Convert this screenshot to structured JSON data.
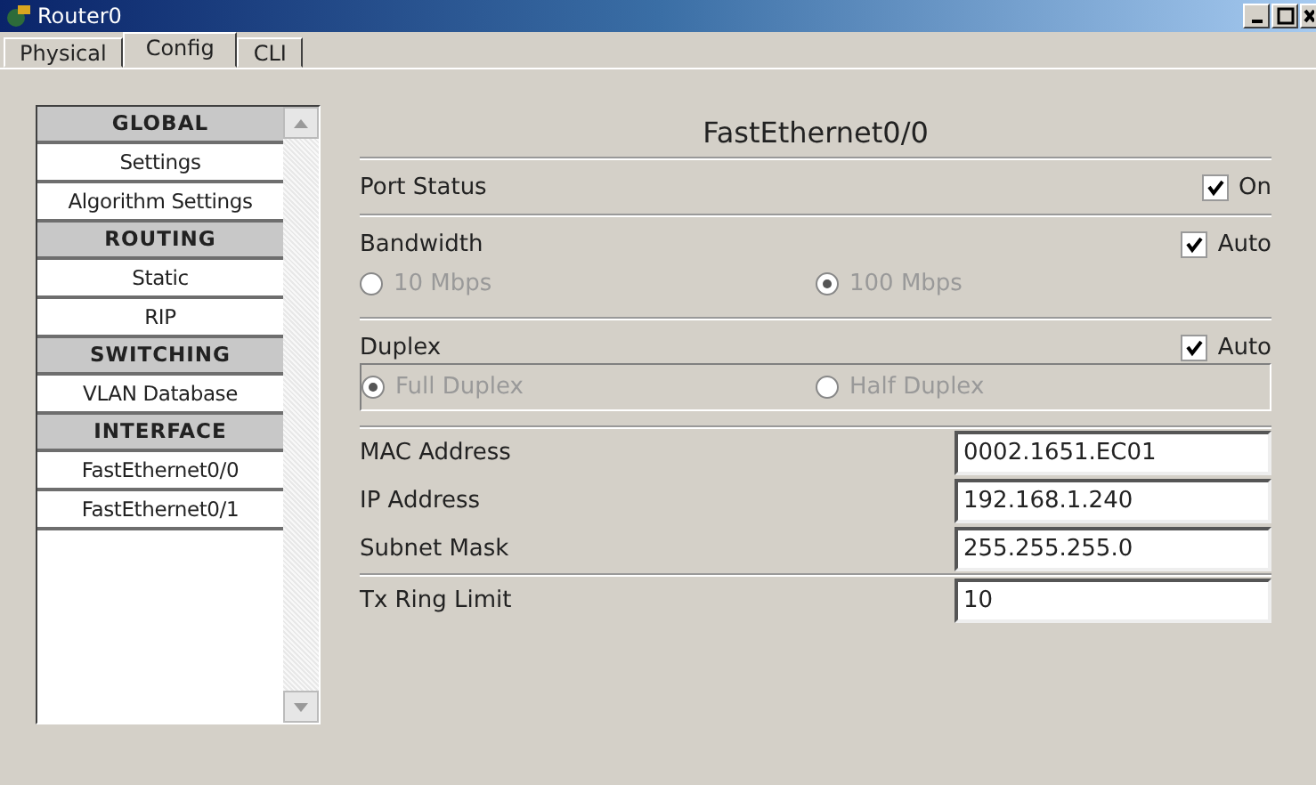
{
  "window": {
    "title": "Router0"
  },
  "tabs": [
    {
      "label": "Physical",
      "selected": false
    },
    {
      "label": "Config",
      "selected": true
    },
    {
      "label": "CLI",
      "selected": false
    }
  ],
  "sidebar": {
    "items": [
      {
        "kind": "header",
        "label": "GLOBAL"
      },
      {
        "kind": "item",
        "label": "Settings"
      },
      {
        "kind": "item",
        "label": "Algorithm Settings"
      },
      {
        "kind": "header",
        "label": "ROUTING"
      },
      {
        "kind": "item",
        "label": "Static"
      },
      {
        "kind": "item",
        "label": "RIP"
      },
      {
        "kind": "header",
        "label": "SWITCHING"
      },
      {
        "kind": "item",
        "label": "VLAN Database"
      },
      {
        "kind": "header",
        "label": "INTERFACE"
      },
      {
        "kind": "item",
        "label": "FastEthernet0/0"
      },
      {
        "kind": "item",
        "label": "FastEthernet0/1"
      }
    ]
  },
  "panel": {
    "title": "FastEthernet0/0",
    "port_status": {
      "label": "Port Status",
      "checkbox": {
        "label": "On",
        "checked": true
      }
    },
    "bandwidth": {
      "label": "Bandwidth",
      "auto": {
        "label": "Auto",
        "checked": true
      },
      "disabled": true,
      "options": [
        {
          "label": "10 Mbps",
          "selected": false
        },
        {
          "label": "100 Mbps",
          "selected": true
        }
      ]
    },
    "duplex": {
      "label": "Duplex",
      "auto": {
        "label": "Auto",
        "checked": true
      },
      "disabled": true,
      "options": [
        {
          "label": "Full Duplex",
          "selected": true
        },
        {
          "label": "Half Duplex",
          "selected": false
        }
      ]
    },
    "fields": [
      {
        "label": "MAC Address",
        "value": "0002.1651.EC01"
      },
      {
        "label": "IP Address",
        "value": "192.168.1.240"
      },
      {
        "label": "Subnet Mask",
        "value": "255.255.255.0"
      }
    ],
    "tx_ring": {
      "label": "Tx Ring Limit",
      "value": "10"
    }
  }
}
